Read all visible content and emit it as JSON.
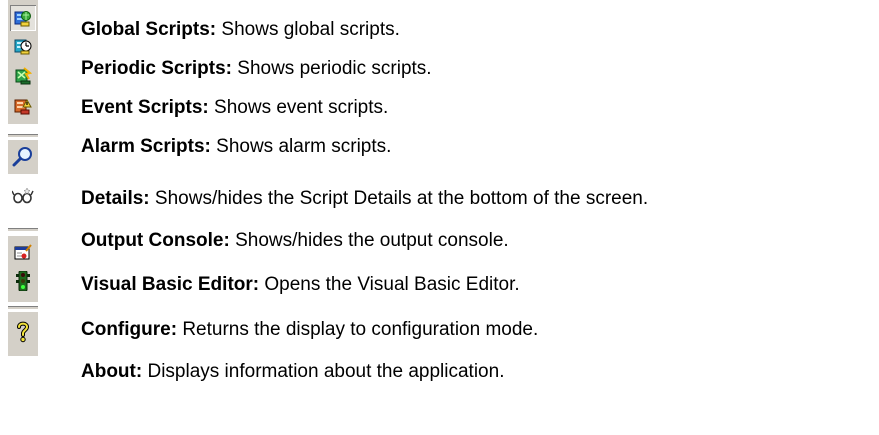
{
  "items": [
    {
      "icon": "global-scripts-icon",
      "title": "Global Scripts:",
      "desc": "Shows global scripts."
    },
    {
      "icon": "periodic-scripts-icon",
      "title": "Periodic Scripts:",
      "desc": "Shows periodic scripts."
    },
    {
      "icon": "event-scripts-icon",
      "title": "Event Scripts:",
      "desc": "Shows event scripts."
    },
    {
      "icon": "alarm-scripts-icon",
      "title": "Alarm Scripts:",
      "desc": "Shows alarm scripts."
    },
    {
      "icon": "magnifier-icon",
      "title": "Details:",
      "desc": "Shows/hides the Script Details at the bottom of the screen."
    },
    {
      "icon": "glasses-icon",
      "title": "Output Console:",
      "desc": "Shows/hides the output console."
    },
    {
      "icon": "vb-editor-icon",
      "title": "Visual Basic Editor:",
      "desc": "Opens the Visual Basic Editor."
    },
    {
      "icon": "traffic-light-icon",
      "title": "Configure:",
      "desc": "Returns the display to configuration mode."
    },
    {
      "icon": "question-mark-icon",
      "title": "About:",
      "desc": "Displays information about the application."
    }
  ],
  "colors": {
    "toolbar_bg": "#d4d0c8",
    "pressed_bg": "#e4e2dc"
  }
}
